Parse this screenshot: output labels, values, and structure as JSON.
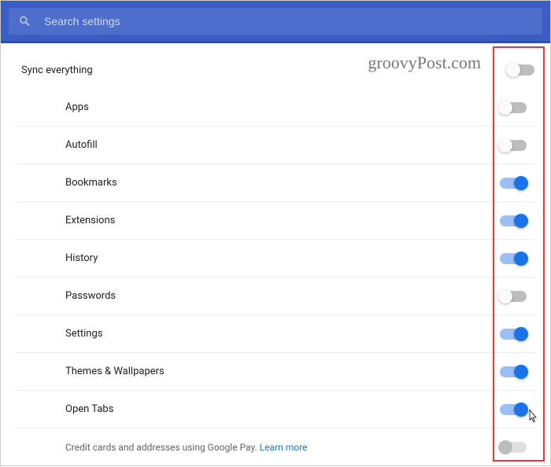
{
  "header": {
    "search_placeholder": "Search settings"
  },
  "sync_everything": {
    "label": "Sync everything",
    "on": false
  },
  "items": [
    {
      "label": "Apps",
      "on": false,
      "disabled": false
    },
    {
      "label": "Autofill",
      "on": false,
      "disabled": false
    },
    {
      "label": "Bookmarks",
      "on": true,
      "disabled": false
    },
    {
      "label": "Extensions",
      "on": true,
      "disabled": false
    },
    {
      "label": "History",
      "on": true,
      "disabled": false
    },
    {
      "label": "Passwords",
      "on": false,
      "disabled": false
    },
    {
      "label": "Settings",
      "on": true,
      "disabled": false
    },
    {
      "label": "Themes & Wallpapers",
      "on": true,
      "disabled": false
    },
    {
      "label": "Open Tabs",
      "on": true,
      "disabled": false
    }
  ],
  "credit": {
    "label": "Credit cards and addresses using Google Pay. ",
    "learn_more": "Learn more",
    "on": false,
    "disabled": true
  },
  "watermark": "groovyPost.com"
}
